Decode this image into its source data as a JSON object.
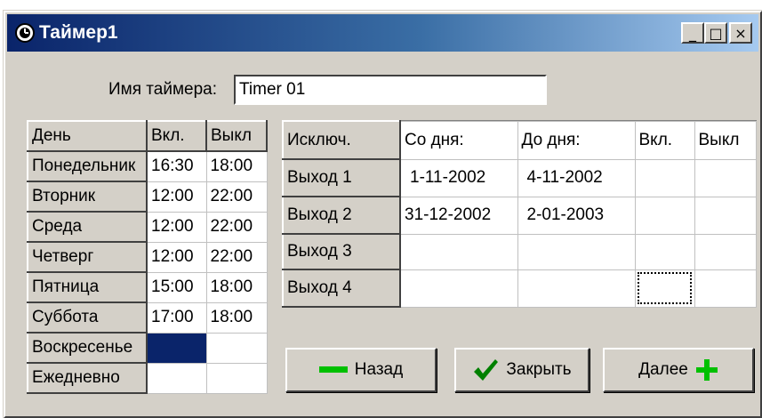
{
  "window": {
    "title": "Таймер1",
    "controls": {
      "minimize": "_",
      "maximize": "□",
      "close": "×"
    }
  },
  "timer_name": {
    "label": "Имя таймера:",
    "value": "Timer 01"
  },
  "schedule": {
    "headers": {
      "day": "День",
      "on": "Вкл.",
      "off": "Выкл"
    },
    "rows": [
      {
        "day": "Понедельник",
        "on": "16:30",
        "off": "18:00"
      },
      {
        "day": "Вторник",
        "on": "12:00",
        "off": "22:00"
      },
      {
        "day": "Среда",
        "on": "12:00",
        "off": "22:00"
      },
      {
        "day": "Четверг",
        "on": "12:00",
        "off": "22:00"
      },
      {
        "day": "Пятница",
        "on": "15:00",
        "off": "18:00"
      },
      {
        "day": "Суббота",
        "on": "17:00",
        "off": "18:00"
      },
      {
        "day": "Воскресенье",
        "on": "",
        "off": ""
      },
      {
        "day": "Ежедневно",
        "on": "",
        "off": ""
      }
    ]
  },
  "exceptions": {
    "headers": {
      "name": "Исключ.",
      "from": "Со дня:",
      "to": "До дня:",
      "on": "Вкл.",
      "off": "Выкл"
    },
    "rows": [
      {
        "name": "Выход 1",
        "from": "1-11-2002",
        "to": "4-11-2002",
        "on": "",
        "off": ""
      },
      {
        "name": "Выход 2",
        "from": "31-12-2002",
        "to": "2-01-2003",
        "on": "",
        "off": ""
      },
      {
        "name": "Выход 3",
        "from": "",
        "to": "",
        "on": "",
        "off": ""
      },
      {
        "name": "Выход 4",
        "from": "",
        "to": "",
        "on": "",
        "off": ""
      }
    ]
  },
  "buttons": {
    "back": "Назад",
    "close": "Закрыть",
    "next": "Далее"
  },
  "colors": {
    "accent_green": "#00c000",
    "selection": "#0a246a",
    "face": "#d4d0c8"
  },
  "icons": {
    "window": "clock-icon",
    "back": "minus-icon",
    "close": "checkmark-icon",
    "next": "plus-icon"
  }
}
